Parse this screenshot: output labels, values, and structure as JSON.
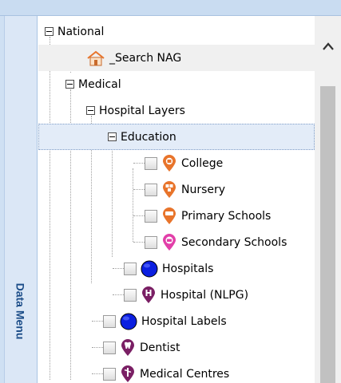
{
  "side_tab": {
    "label": "Data Menu"
  },
  "tree": {
    "national": "National",
    "search_nag": "_Search NAG",
    "medical": "Medical",
    "hospital_layers": "Hospital Layers",
    "education": "Education",
    "college": "College",
    "nursery": "Nursery",
    "primary_schools": "Primary Schools",
    "secondary_schools": "Secondary Schools",
    "hospitals": "Hospitals",
    "hospital_nlpg": "Hospital (NLPG)",
    "hospital_labels": "Hospital Labels",
    "dentist": "Dentist",
    "medical_centres": "Medical Centres"
  },
  "colors": {
    "orange_pin": "#e8742b",
    "pink_pin": "#e23fa9",
    "blue_dot": "#0b1fe0",
    "purple_pin": "#7a1f64",
    "side_label": "#1d4e89"
  },
  "icons": {
    "house": "house-icon",
    "college": "college-pin-icon",
    "nursery": "nursery-pin-icon",
    "primary": "primary-school-pin-icon",
    "secondary": "secondary-school-pin-icon",
    "hospitals": "blue-circle-icon",
    "nlpg": "hospital-pin-icon",
    "labels": "blue-circle-icon",
    "dentist": "tooth-pin-icon",
    "medical": "medical-centre-pin-icon"
  }
}
